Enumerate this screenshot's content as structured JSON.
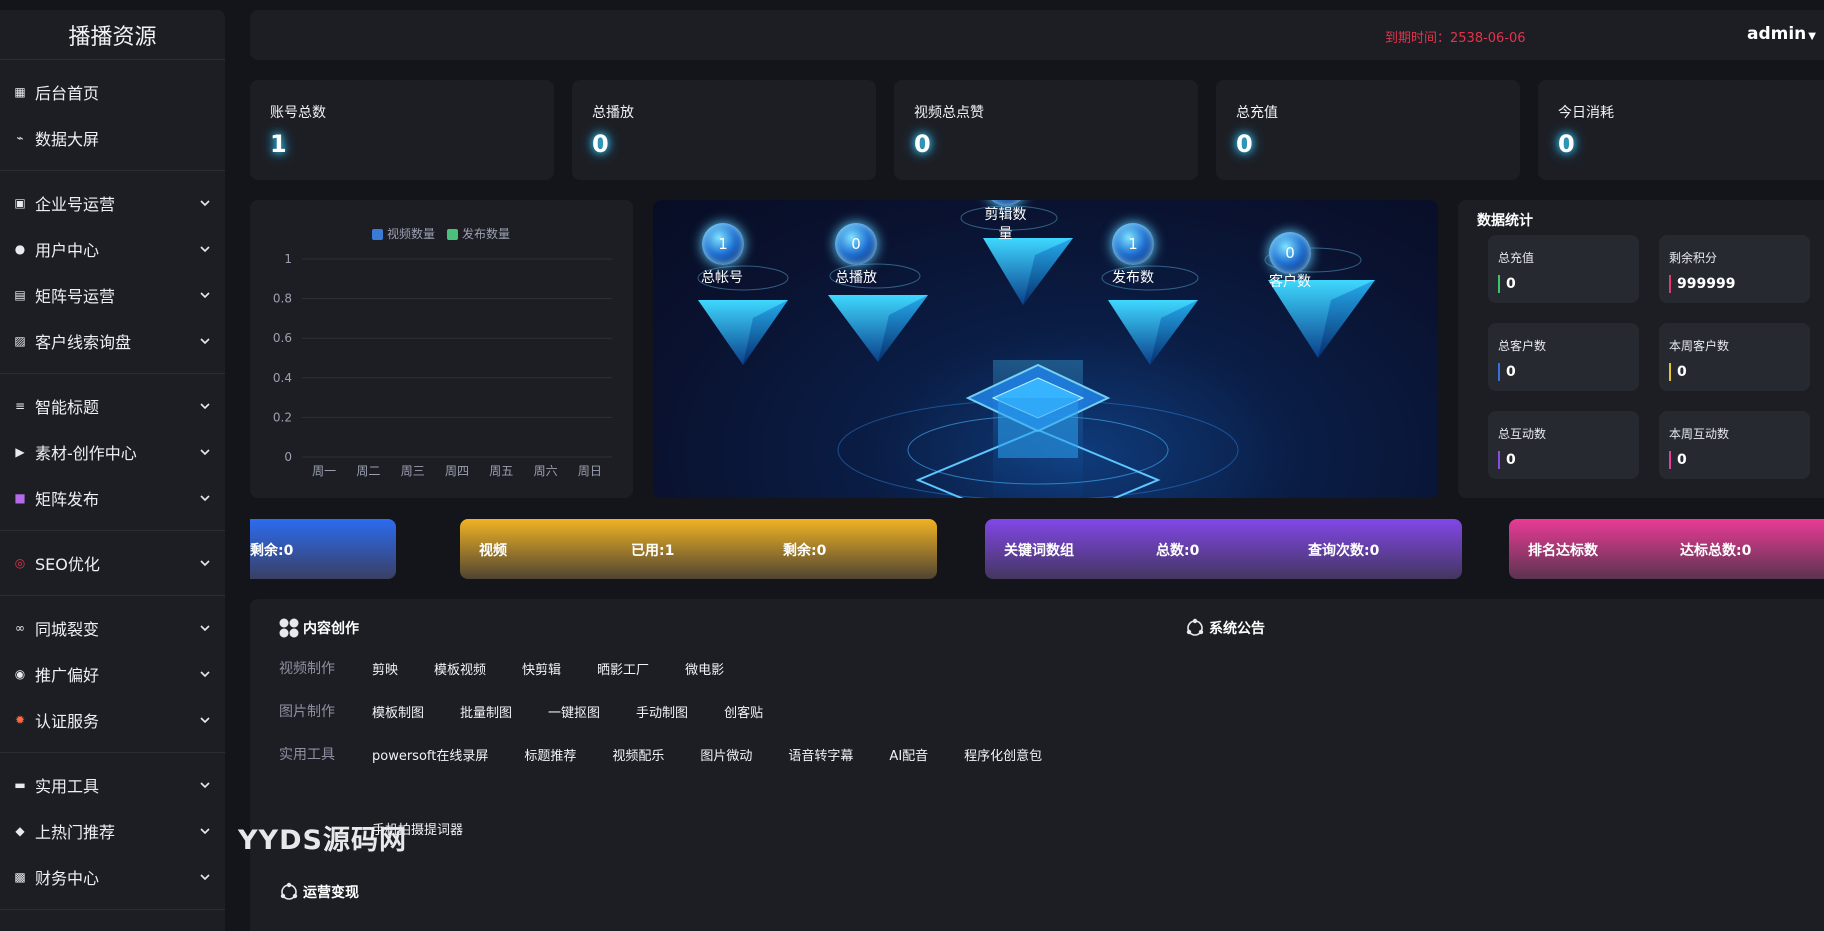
{
  "sidebar": {
    "brand": "播播资源",
    "groups": [
      [
        {
          "label": "后台首页",
          "icon": "dashboard-icon"
        },
        {
          "label": "数据大屏",
          "icon": "chart-icon"
        }
      ],
      [
        {
          "label": "企业号运营",
          "icon": "building-icon"
        },
        {
          "label": "用户中心",
          "icon": "user-icon"
        },
        {
          "label": "矩阵号运营",
          "icon": "matrix-icon"
        },
        {
          "label": "客户线索询盘",
          "icon": "image-icon"
        }
      ],
      [
        {
          "label": "智能标题",
          "icon": "layers-icon"
        },
        {
          "label": "素材-创作中心",
          "icon": "play-icon"
        },
        {
          "label": "矩阵发布",
          "icon": "video-icon"
        }
      ],
      [
        {
          "label": "SEO优化",
          "icon": "seo-icon"
        }
      ],
      [
        {
          "label": "同城裂变",
          "icon": "link-icon"
        },
        {
          "label": "推广偏好",
          "icon": "robot-icon"
        },
        {
          "label": "认证服务",
          "icon": "badge-icon"
        }
      ],
      [
        {
          "label": "实用工具",
          "icon": "briefcase-icon"
        },
        {
          "label": "上热门推荐",
          "icon": "flame-icon"
        },
        {
          "label": "财务中心",
          "icon": "archive-icon"
        }
      ]
    ]
  },
  "topbar": {
    "expire": "到期时间：2538-06-06",
    "user": "admin"
  },
  "stats": [
    {
      "title": "账号总数",
      "value": "1"
    },
    {
      "title": "总播放",
      "value": "0"
    },
    {
      "title": "视频总点赞",
      "value": "0"
    },
    {
      "title": "总充值",
      "value": "0"
    },
    {
      "title": "今日消耗",
      "value": "0"
    }
  ],
  "chart_data": {
    "type": "bar",
    "categories": [
      "周一",
      "周二",
      "周三",
      "周四",
      "周五",
      "周六",
      "周日"
    ],
    "series": [
      {
        "name": "视频数量",
        "values": [
          0,
          0,
          0,
          0,
          0,
          0,
          0
        ],
        "color": "#3a7bd5"
      },
      {
        "name": "发布数量",
        "values": [
          0,
          0,
          0,
          0,
          0,
          0,
          0
        ],
        "color": "#4bc07a"
      }
    ],
    "ylim": [
      0,
      1
    ],
    "yticks": [
      "1",
      "0.8",
      "0.6",
      "0.4",
      "0.2",
      "0"
    ],
    "legend": "top-center",
    "grid": true
  },
  "hero": {
    "nodes": [
      {
        "label": "总帐号",
        "value": "1"
      },
      {
        "label": "总播放",
        "value": "0"
      },
      {
        "label": "剪辑数量",
        "value": "0"
      },
      {
        "label": "发布数",
        "value": "1"
      },
      {
        "label": "客户数",
        "value": "0"
      }
    ]
  },
  "panel": {
    "title": "数据统计",
    "items": [
      {
        "title": "总充值",
        "value": "0",
        "color": "#3bc66b"
      },
      {
        "title": "剩余积分",
        "value": "999999",
        "color": "#e23a6b"
      },
      {
        "title": "总客户数",
        "value": "0",
        "color": "#3a6fe0"
      },
      {
        "title": "本周客户数",
        "value": "0",
        "color": "#e6c233"
      },
      {
        "title": "总互动数",
        "value": "0",
        "color": "#8a4be0"
      },
      {
        "title": "本周互动数",
        "value": "0",
        "color": "#e2409e"
      }
    ]
  },
  "banners": {
    "b1": {
      "t1": "剩余:0"
    },
    "b2": {
      "t1": "视频",
      "t2": "已用:1",
      "t3": "剩余:0"
    },
    "b3": {
      "t1": "关键词数组",
      "t2": "总数:0",
      "t3": "查询次数:0"
    },
    "b4": {
      "t1": "排名达标数",
      "t2": "达标总数:0"
    }
  },
  "content": {
    "section1": "内容创作",
    "section2": "系统公告",
    "section3": "运营变现",
    "rows": [
      {
        "key": "视频制作",
        "items": [
          "剪映",
          "模板视频",
          "快剪辑",
          "晒影工厂",
          "微电影"
        ]
      },
      {
        "key": "图片制作",
        "items": [
          "模板制图",
          "批量制图",
          "一键抠图",
          "手动制图",
          "创客贴"
        ]
      },
      {
        "key": "实用工具",
        "items": [
          "powersoft在线录屏",
          "标题推荐",
          "视频配乐",
          "图片微动",
          "语音转字幕",
          "AI配音",
          "程序化创意包"
        ]
      }
    ],
    "extra": "手机拍摄提词器"
  },
  "watermark": "YYDS源码网"
}
